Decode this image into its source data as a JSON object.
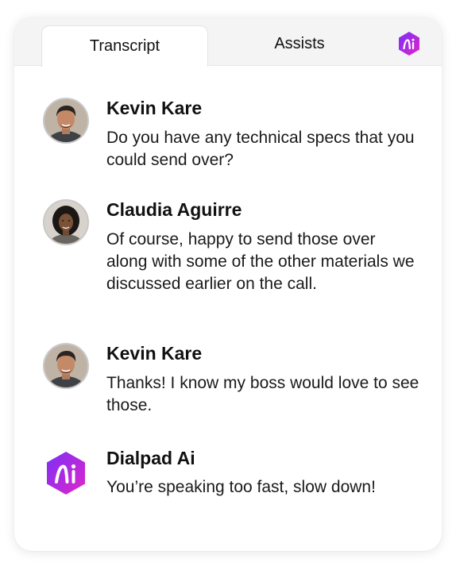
{
  "tabs": {
    "transcript_label": "Transcript",
    "assists_label": "Assists",
    "ai_icon": "dialpad-ai-icon"
  },
  "colors": {
    "ai_gradient_start": "#7b2ff7",
    "ai_gradient_end": "#e026c9",
    "tab_bar_bg": "#f4f4f4",
    "text": "#111111"
  },
  "messages": [
    {
      "name": "Kevin Kare",
      "text": "Do you have any technical specs that you could send over?",
      "avatar": "avatar-photo"
    },
    {
      "name": "Claudia Aguirre",
      "text": "Of course, happy to send those over along with some of the other materials we discussed earlier on the call.",
      "avatar": "avatar-photo"
    },
    {
      "name": "Kevin Kare",
      "text": "Thanks! I know my boss would love to see those.",
      "avatar": "avatar-photo"
    },
    {
      "name": "Dialpad Ai",
      "text": "You’re speaking too fast, slow down!",
      "avatar": "dialpad-ai-icon"
    }
  ]
}
